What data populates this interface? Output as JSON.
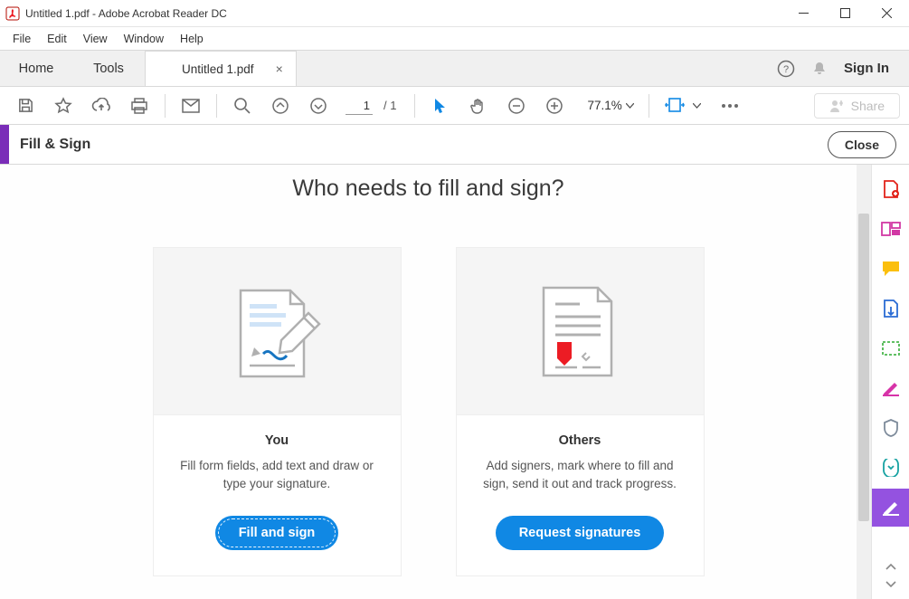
{
  "titlebar": {
    "title": "Untitled 1.pdf - Adobe Acrobat Reader DC"
  },
  "menu": {
    "file": "File",
    "edit": "Edit",
    "view": "View",
    "window": "Window",
    "help": "Help"
  },
  "tabs": {
    "home": "Home",
    "tools": "Tools",
    "doc": "Untitled 1.pdf",
    "signin": "Sign In"
  },
  "toolbar": {
    "page_current": "1",
    "page_total": "/ 1",
    "zoom": "77.1%",
    "share": "Share"
  },
  "subtool": {
    "label": "Fill & Sign",
    "close": "Close"
  },
  "content": {
    "heading": "Who needs to fill and sign?",
    "card_you": {
      "title": "You",
      "desc": "Fill form fields, add text and draw or type your signature.",
      "button": "Fill and sign"
    },
    "card_others": {
      "title": "Others",
      "desc": "Add signers, mark where to fill and sign, send it out and track progress.",
      "button": "Request signatures"
    }
  }
}
